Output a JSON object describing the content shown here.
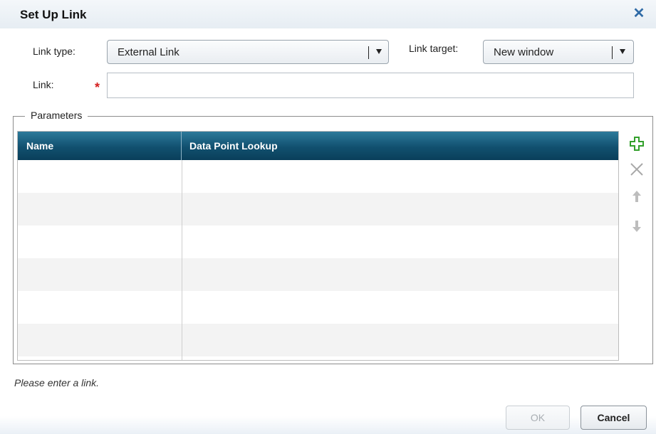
{
  "dialog": {
    "title": "Set Up Link",
    "close_icon": "close-icon"
  },
  "form": {
    "link_type_label": "Link type:",
    "link_type_value": "External Link",
    "link_target_label": "Link target:",
    "link_target_value": "New window",
    "link_label": "Link:",
    "required_marker": "*",
    "link_value": ""
  },
  "parameters": {
    "legend": "Parameters",
    "columns": [
      "Name",
      "Data Point Lookup"
    ],
    "rows": [],
    "tools": [
      "add-icon",
      "delete-icon",
      "move-up-icon",
      "move-down-icon"
    ]
  },
  "status": {
    "message": "Please enter a link."
  },
  "buttons": {
    "ok": "OK",
    "cancel": "Cancel"
  },
  "colors": {
    "header_bg": "#11506f",
    "add_icon": "#33a02c",
    "close_icon": "#2f6aa6",
    "required": "#d42020"
  }
}
